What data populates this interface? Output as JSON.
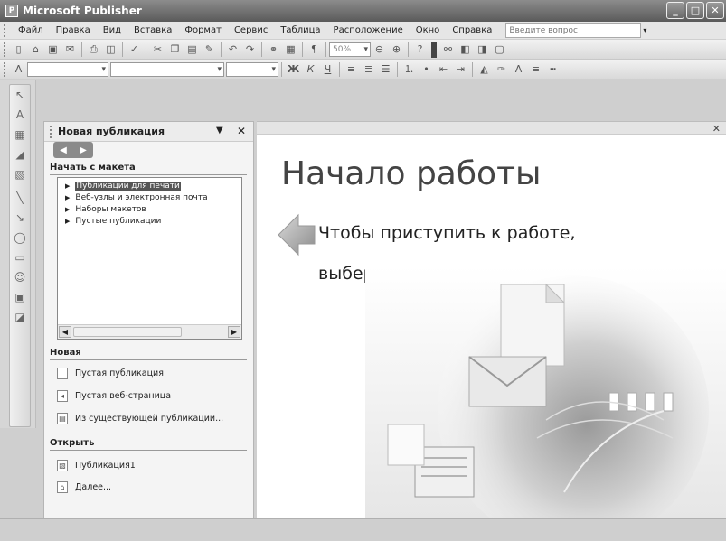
{
  "window": {
    "title": "Microsoft Publisher",
    "app_icon": "P"
  },
  "menubar": {
    "items": [
      "Файл",
      "Правка",
      "Вид",
      "Вставка",
      "Формат",
      "Сервис",
      "Таблица",
      "Расположение",
      "Окно",
      "Справка"
    ],
    "help_placeholder": "Введите вопрос"
  },
  "toolbar_formatting": {
    "zoom_value": "50%",
    "bold": "Ж",
    "italic": "К",
    "underline": "Ч"
  },
  "taskpane": {
    "title": "Новая публикация",
    "section_start": "Начать с макета",
    "layouts": [
      "Публикации для печати",
      "Веб-узлы и электронная почта",
      "Наборы макетов",
      "Пустые публикации"
    ],
    "section_new": "Новая",
    "new_items": [
      "Пустая публикация",
      "Пустая веб-страница",
      "Из существующей публикации..."
    ],
    "section_open": "Открыть",
    "open_items": [
      "Публикация1",
      "Далее..."
    ]
  },
  "workspace": {
    "heading": "Начало работы",
    "hint_line1": "Чтобы приступить к работе,",
    "hint_line2": "выберите вариант из списка."
  },
  "colors": {
    "titlebar": "#6e6e6e",
    "taskpane_bg": "#f4f4f4",
    "selected_item": "#555555"
  }
}
